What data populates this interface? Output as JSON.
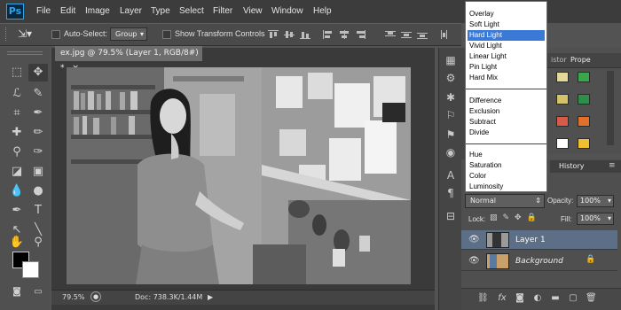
{
  "app": {
    "logo": "Ps"
  },
  "menu": [
    "File",
    "Edit",
    "Image",
    "Layer",
    "Type",
    "Select",
    "Filter",
    "View",
    "Window",
    "Help"
  ],
  "options_bar": {
    "auto_select_label": "Auto-Select:",
    "auto_select_value": "Group",
    "transform_controls_label": "Show Transform Controls"
  },
  "document": {
    "tab_title": "ex.jpg @ 79.5% (Layer 1, RGB/8#) *",
    "tab_close": "×",
    "zoom": "79.5%",
    "doc_size": "Doc: 738.3K/1.44M"
  },
  "panels": {
    "tabs_partial": [
      "istor",
      "Prope"
    ],
    "history_tab": "History"
  },
  "layers": {
    "blend_mode": "Normal",
    "opacity_label": "Opacity:",
    "opacity_value": "100%",
    "lock_label": "Lock:",
    "fill_label": "Fill:",
    "fill_value": "100%",
    "items": [
      {
        "name": "Layer 1",
        "selected": true
      },
      {
        "name": "Background",
        "selected": false,
        "locked": true
      }
    ]
  },
  "blend_dropdown": {
    "groups": [
      [
        "Overlay",
        "Soft Light",
        "Hard Light",
        "Vivid Light",
        "Linear Light",
        "Pin Light",
        "Hard Mix"
      ],
      [
        "Difference",
        "Exclusion",
        "Subtract",
        "Divide"
      ],
      [
        "Hue",
        "Saturation",
        "Color",
        "Luminosity"
      ]
    ],
    "selected": "Hard Light"
  },
  "colors": {
    "accent": "#3b79d6",
    "selected_layer": "#5d6f86",
    "swatches": [
      "#e6d79a",
      "#3aa84a",
      "#d4c36a",
      "#2f8f4a",
      "#d85a4a",
      "#e0702a",
      "#ffffff",
      "#f0c030"
    ]
  }
}
